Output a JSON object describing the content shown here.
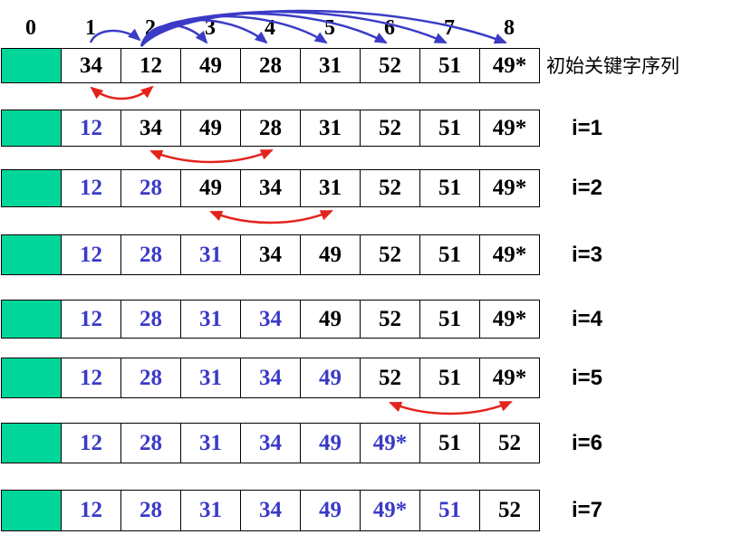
{
  "index_labels": [
    "0",
    "1",
    "2",
    "3",
    "4",
    "5",
    "6",
    "7",
    "8"
  ],
  "comparisons": [
    [
      1,
      2
    ],
    [
      2,
      3
    ],
    [
      2,
      4
    ],
    [
      2,
      5
    ],
    [
      2,
      6
    ],
    [
      2,
      7
    ],
    [
      2,
      8
    ]
  ],
  "rows": [
    {
      "values": [
        "34",
        "12",
        "49",
        "28",
        "31",
        "52",
        "51",
        "49*"
      ],
      "sorted": 0,
      "label": "初始关键字序列",
      "swap": [
        1,
        2
      ]
    },
    {
      "values": [
        "12",
        "34",
        "49",
        "28",
        "31",
        "52",
        "51",
        "49*"
      ],
      "sorted": 1,
      "label": "i=1",
      "swap": [
        2,
        4
      ]
    },
    {
      "values": [
        "12",
        "28",
        "49",
        "34",
        "31",
        "52",
        "51",
        "49*"
      ],
      "sorted": 2,
      "label": "i=2",
      "swap": [
        3,
        5
      ]
    },
    {
      "values": [
        "12",
        "28",
        "31",
        "34",
        "49",
        "52",
        "51",
        "49*"
      ],
      "sorted": 3,
      "label": "i=3",
      "swap": null
    },
    {
      "values": [
        "12",
        "28",
        "31",
        "34",
        "49",
        "52",
        "51",
        "49*"
      ],
      "sorted": 4,
      "label": "i=4",
      "swap": null
    },
    {
      "values": [
        "12",
        "28",
        "31",
        "34",
        "49",
        "52",
        "51",
        "49*"
      ],
      "sorted": 5,
      "label": "i=5",
      "swap": [
        6,
        8
      ]
    },
    {
      "values": [
        "12",
        "28",
        "31",
        "34",
        "49",
        "49*",
        "51",
        "52"
      ],
      "sorted": 6,
      "label": "i=6",
      "swap": null
    },
    {
      "values": [
        "12",
        "28",
        "31",
        "34",
        "49",
        "49*",
        "51",
        "52"
      ],
      "sorted": 7,
      "label": "i=7",
      "swap": null
    }
  ],
  "colors": {
    "sentinel": "#00d69a",
    "sorted_text": "#3a3ac8",
    "unsorted_text": "#000000",
    "swap_arrow": "#e3231c",
    "compare_arrow": "#3b3bc6",
    "border": "#000000"
  }
}
